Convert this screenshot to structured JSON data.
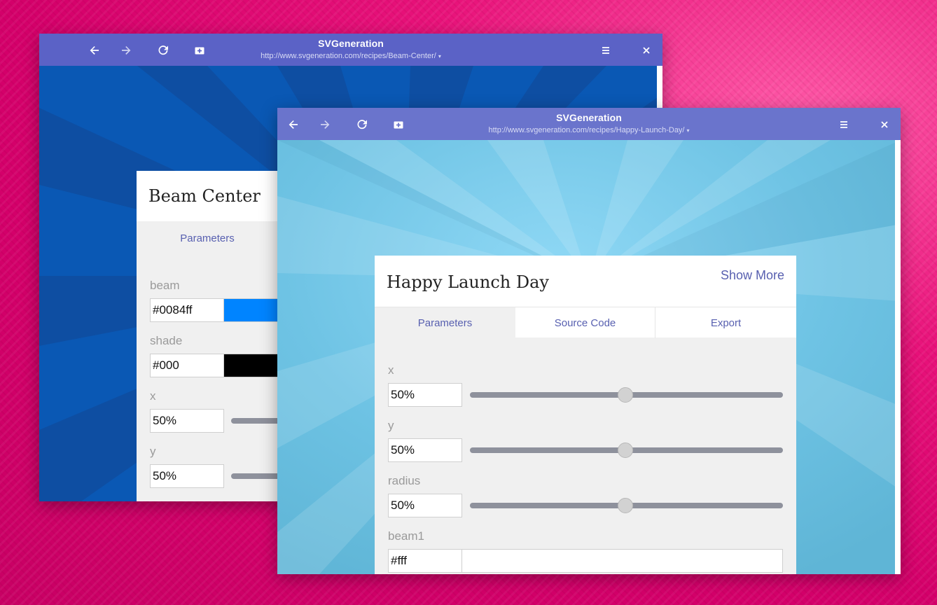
{
  "back_window": {
    "title": "SVGeneration",
    "url": "http://www.svgeneration.com/recipes/Beam-Center/",
    "url_caret": "▾",
    "card_title": "Beam Center",
    "tab_parameters": "Parameters",
    "params": {
      "beam_label": "beam",
      "beam_value": "#0084ff",
      "beam_color": "#0084ff",
      "shade_label": "shade",
      "shade_value": "#000",
      "shade_color": "#000000",
      "x_label": "x",
      "x_value": "50%",
      "y_label": "y",
      "y_value": "50%"
    }
  },
  "front_window": {
    "title": "SVGeneration",
    "url": "http://www.svgeneration.com/recipes/Happy-Launch-Day/",
    "url_caret": "▾",
    "card_title": "Happy Launch Day",
    "show_more": "Show More",
    "tabs": {
      "parameters": "Parameters",
      "source_code": "Source Code",
      "export": "Export"
    },
    "params": {
      "x_label": "x",
      "x_value": "50%",
      "x_slider": 0.5,
      "y_label": "y",
      "y_value": "50%",
      "y_slider": 0.5,
      "radius_label": "radius",
      "radius_value": "50%",
      "radius_slider": 0.5,
      "beam1_label": "beam1",
      "beam1_value": "#fff",
      "beam1_color": "#ffffff"
    }
  },
  "icons": [
    "back-arrow-icon",
    "forward-arrow-icon",
    "reload-icon",
    "new-tab-icon",
    "menu-icon",
    "close-icon"
  ],
  "colors": {
    "titlebar_back": "#5b62c6",
    "titlebar_front": "#6a74cc",
    "accent_text": "#5860b0",
    "desktop": "#e8127a"
  }
}
